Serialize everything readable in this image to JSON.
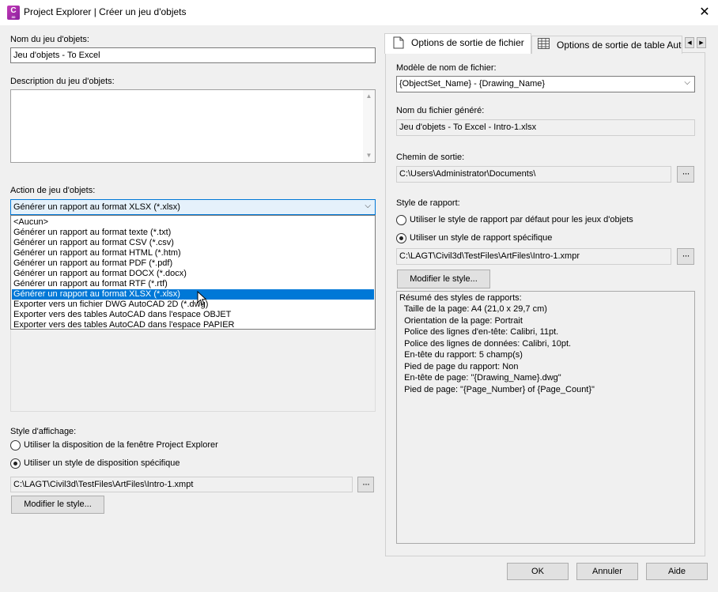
{
  "window": {
    "title": "Project Explorer | Créer un jeu d'objets",
    "app_icon_letter": "C",
    "app_icon_sub": "3D",
    "close_glyph": "✕"
  },
  "left": {
    "name_label": "Nom du jeu d'objets:",
    "name_value": "Jeu d'objets - To Excel",
    "description_label": "Description du jeu d'objets:",
    "description_value": "",
    "action_label": "Action de jeu d'objets:",
    "action_selected": "Générer un rapport au format XLSX (*.xlsx)",
    "action_options": [
      "<Aucun>",
      "Générer un rapport au format texte (*.txt)",
      "Générer un rapport au format CSV (*.csv)",
      "Générer un rapport au format HTML (*.htm)",
      "Générer un rapport au format PDF (*.pdf)",
      "Générer un rapport au format DOCX (*.docx)",
      "Générer un rapport au format RTF (*.rtf)",
      "Générer un rapport au format XLSX (*.xlsx)",
      "Exporter vers un fichier DWG AutoCAD 2D (*.dwg)",
      "Exporter vers des tables AutoCAD dans l'espace OBJET",
      "Exporter vers des tables AutoCAD dans l'espace PAPIER"
    ],
    "display_style_label": "Style d'affichage:",
    "radio_use_window_layout": "Utiliser la disposition de la fenêtre Project Explorer",
    "radio_use_specific_layout": "Utiliser un style de disposition spécifique",
    "layout_path": "C:\\LAGT\\Civil3d\\TestFiles\\ArtFiles\\Intro-1.xmpt",
    "modify_style_button": "Modifier le style..."
  },
  "right": {
    "tabs": [
      {
        "label": "Options de sortie de fichier",
        "icon": "document-icon"
      },
      {
        "label": "Options de sortie de table AutoCAD",
        "icon": "table-icon"
      }
    ],
    "filename_model_label": "Modèle de nom de fichier:",
    "filename_model_value": "{ObjectSet_Name} - {Drawing_Name}",
    "generated_filename_label": "Nom du fichier généré:",
    "generated_filename_value": "Jeu d'objets - To Excel - Intro-1.xlsx",
    "output_path_label": "Chemin de sortie:",
    "output_path_value": "C:\\Users\\Administrator\\Documents\\",
    "report_style_label": "Style de rapport:",
    "radio_default_style": "Utiliser le style de rapport par défaut pour les jeux d'objets",
    "radio_specific_style": "Utiliser un style de rapport spécifique",
    "report_style_path": "C:\\LAGT\\Civil3d\\TestFiles\\ArtFiles\\Intro-1.xmpr",
    "modify_style_button": "Modifier le style...",
    "summary_lines": [
      "Résumé des styles de rapports:",
      "  Taille de la page: A4 (21,0 x 29,7 cm)",
      "  Orientation de la page: Portrait",
      "  Police des lignes d'en-tête: Calibri, 11pt.",
      "  Police des lignes de données: Calibri, 10pt.",
      "  En-tête du rapport: 5 champ(s)",
      "  Pied de page du rapport: Non",
      "  En-tête de page: \"{Drawing_Name}.dwg\"",
      "  Pied de page: \"{Page_Number} of {Page_Count}\""
    ]
  },
  "footer": {
    "ok": "OK",
    "cancel": "Annuler",
    "help": "Aide"
  },
  "glyphs": {
    "dots": "···",
    "chevron_down": "⌵",
    "scroll_up": "▲",
    "scroll_down": "▼",
    "tab_left": "◀",
    "tab_right": "▶"
  }
}
